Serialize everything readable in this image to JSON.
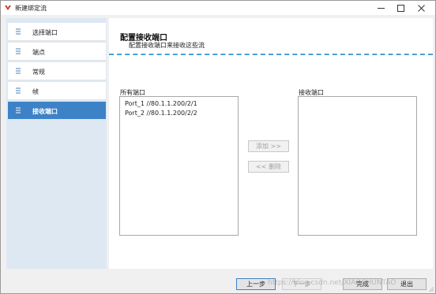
{
  "window": {
    "title": "新建绑定流",
    "controls": {
      "minimize": "—",
      "maximize": "☐",
      "close": "✕"
    }
  },
  "sidebar": {
    "items": [
      {
        "label": "选择端口",
        "icon": "hamburger-icon",
        "active": false
      },
      {
        "label": "端点",
        "icon": "hamburger-icon",
        "active": false
      },
      {
        "label": "常规",
        "icon": "hamburger-icon",
        "active": false
      },
      {
        "label": "帧",
        "icon": "hamburger-icon",
        "active": false
      },
      {
        "label": "接收端口",
        "icon": "hamburger-icon",
        "active": true
      }
    ]
  },
  "main": {
    "title": "配置接收端口",
    "subtitle": "配置接收端口来接收这些流",
    "all_ports": {
      "label": "所有端口",
      "items": [
        "Port_1 //80.1.1.200/2/1",
        "Port_2 //80.1.1.200/2/2"
      ]
    },
    "receive_ports": {
      "label": "接收端口",
      "items": []
    },
    "add_button": "添加 >>",
    "remove_button": "<< 删除"
  },
  "footer": {
    "prev": "上一步",
    "next": "下一步",
    "finish": "完成",
    "cancel": "退出",
    "watermark": "https://blog.csdn.net/XIAOCHUNTAO"
  },
  "colors": {
    "accent": "#3d82c7",
    "sidebar_bg": "#dde8f3",
    "dash": "#4a9fd4",
    "app_icon": "#c0392b"
  }
}
